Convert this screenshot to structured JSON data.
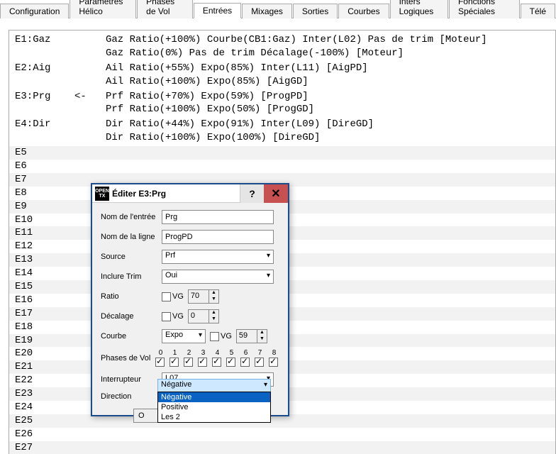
{
  "tabs": [
    "Configuration",
    "Paramètres Hélico",
    "Phases de Vol",
    "Entrées",
    "Mixages",
    "Sorties",
    "Courbes",
    "Inters Logiques",
    "Fonctions Spéciales",
    "Télé"
  ],
  "active_tab": 3,
  "entries": [
    {
      "label": "E1:Gaz",
      "lines": [
        "Gaz Ratio(+100%) Courbe(CB1:Gaz) Inter(L02) Pas de trim [Moteur]",
        "Gaz Ratio(0%) Pas de trim Décalage(-100%) [Moteur]"
      ]
    },
    {
      "label": "E2:Aig",
      "lines": [
        "Ail Ratio(+55%) Expo(85%) Inter(L11) [AigPD]",
        "Ail Ratio(+100%) Expo(85%) [AigGD]"
      ]
    },
    {
      "label": "E3:Prg",
      "marker": "<-",
      "lines": [
        "Prf Ratio(+70%) Expo(59%) [ProgPD]",
        "Prf Ratio(+100%) Expo(50%) [ProgGD]"
      ]
    },
    {
      "label": "E4:Dir",
      "lines": [
        "Dir Ratio(+44%) Expo(91%) Inter(L09) [DireGD]",
        "Dir Ratio(+100%) Expo(100%) [DireGD]"
      ]
    }
  ],
  "empty_rows": [
    "E5",
    "E6",
    "E7",
    "E8",
    "E9",
    "E10",
    "E11",
    "E12",
    "E13",
    "E14",
    "E15",
    "E16",
    "E17",
    "E18",
    "E19",
    "E20",
    "E21",
    "E22",
    "E23",
    "E24",
    "E25",
    "E26",
    "E27"
  ],
  "dialog": {
    "title": "Éditer E3:Prg",
    "labels": {
      "name": "Nom de l'entrée",
      "line": "Nom de la ligne",
      "source": "Source",
      "trim": "Inclure Trim",
      "ratio": "Ratio",
      "offset": "Décalage",
      "curve": "Courbe",
      "phases": "Phases de Vol",
      "switch": "Interrupteur",
      "direction": "Direction",
      "vg": "VG"
    },
    "values": {
      "name": "Prg",
      "line": "ProgPD",
      "source": "Prf",
      "trim": "Oui",
      "ratio": "70",
      "offset": "0",
      "curve_type": "Expo",
      "curve_val": "59",
      "switch": "L07",
      "direction": "Négative",
      "ratio_vg": false,
      "offset_vg": false,
      "curve_vg": false
    },
    "phases": [
      "0",
      "1",
      "2",
      "3",
      "4",
      "5",
      "6",
      "7",
      "8"
    ],
    "phases_checked": [
      true,
      true,
      true,
      true,
      true,
      true,
      true,
      true,
      true
    ],
    "direction_options": [
      "Négative",
      "Positive",
      "Les 2"
    ],
    "ok": "O"
  }
}
